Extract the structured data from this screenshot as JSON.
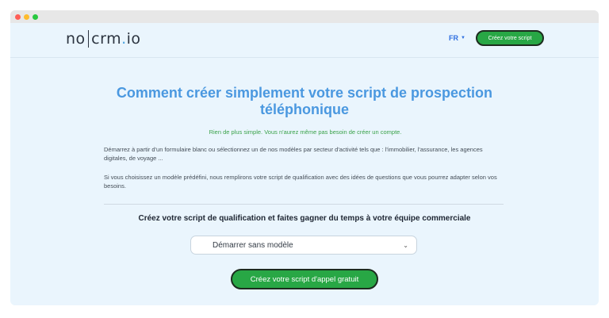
{
  "nav": {
    "logo_no": "no",
    "logo_crm": "crm",
    "logo_dot": ".",
    "logo_io": "io",
    "lang": "FR",
    "cta": "Créez votre script"
  },
  "main": {
    "headline": "Comment créer simplement votre script de prospection téléphonique",
    "subtitle": "Rien de plus simple. Vous n'aurez même pas besoin de créer un compte.",
    "paragraph1": "Démarrez à partir d'un formulaire blanc ou sélectionnez un de nos modèles par secteur d'activité tels que : l'immobilier, l'assurance, les agences digitales, de voyage ...",
    "paragraph2": "Si vous choisissez un modèle prédéfini, nous remplirons votre script de qualification avec des idées de questions que vous pourrez adapter selon vos besoins.",
    "form_title": "Créez votre script de qualification et faites gagner du temps à votre équipe commerciale",
    "select_value": "Démarrer sans modèle",
    "cta": "Créez votre script d'appel gratuit"
  },
  "colors": {
    "accent_blue": "#4a98e0",
    "cta_green": "#28a745",
    "subtitle_green": "#3aa24a",
    "background": "#eaf5fd"
  },
  "icons": {
    "lang_caret": "caret-down-icon",
    "select_chevron": "chevron-down-icon"
  }
}
